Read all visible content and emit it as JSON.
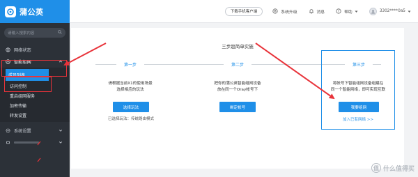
{
  "app": {
    "name": "蒲公英"
  },
  "sidebar": {
    "search_placeholder": "请输入搜索内容",
    "items": [
      {
        "label": "网络状态"
      },
      {
        "label": "智能组网"
      },
      {
        "label": "系统设置"
      },
      {
        "label": ""
      }
    ],
    "sub_items": [
      {
        "label": "成员列表"
      },
      {
        "label": "访问控制"
      },
      {
        "label": "重启组网服务"
      },
      {
        "label": "加密传输"
      },
      {
        "label": "转发设置"
      }
    ]
  },
  "topbar": {
    "download_label": "下载手机客户端",
    "upgrade_label": "系统升级",
    "messages_label": "消息",
    "help_label": "帮助",
    "account_label": "3302****0a5"
  },
  "main": {
    "title": "三步超简单实施",
    "steps": [
      {
        "label": "第一步",
        "desc_line1": "请根据当前X1的使用场景",
        "desc_line2": "选择相应的玩法",
        "button": "选择玩法",
        "note": "已选择玩法：传统路由模式"
      },
      {
        "label": "第二步",
        "desc_line1": "把你的蒲公英智能组网设备",
        "desc_line2": "放在同一个Oray帐号下",
        "button": "绑定帐号"
      },
      {
        "label": "第三步",
        "desc_line1": "将帐号下智能组网设备组建在",
        "desc_line2": "同一个智能网络，即可实现互联",
        "button": "我要组网",
        "link": "加入已有网络 >>"
      }
    ]
  },
  "watermark": {
    "text": "什么值得买",
    "logo_char": "值"
  },
  "colors": {
    "accent": "#1f8fe8",
    "sidebar": "#2c3138",
    "annotation": "#e8333a"
  }
}
